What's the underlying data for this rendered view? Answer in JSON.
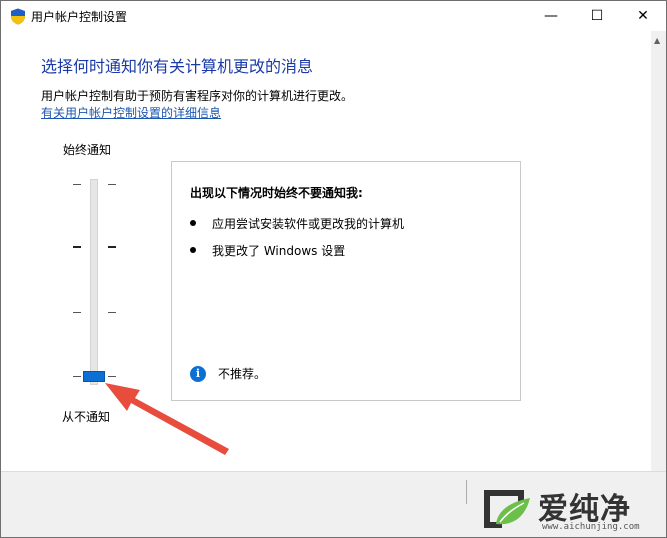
{
  "window": {
    "title": "用户帐户控制设置"
  },
  "titlebar": {
    "minimize": "—",
    "maximize": "☐",
    "close": "✕"
  },
  "main": {
    "heading": "选择何时通知你有关计算机更改的消息",
    "description": "用户帐户控制有助于预防有害程序对你的计算机进行更改。",
    "link": "有关用户帐户控制设置的详细信息"
  },
  "slider": {
    "top_label": "始终通知",
    "bottom_label": "从不通知",
    "levels": 4,
    "selected_level": 0
  },
  "panel": {
    "title": "出现以下情况时始终不要通知我:",
    "items": [
      "应用尝试安装软件或更改我的计算机",
      "我更改了 Windows 设置"
    ],
    "note": "不推荐。"
  },
  "watermark": {
    "brand": "爱纯净",
    "url": "www.aichunjing.com"
  },
  "colors": {
    "heading": "#1a3aa8",
    "link": "#1a56b0",
    "accent": "#0c6fd4",
    "arrow": "#e74c3c"
  }
}
